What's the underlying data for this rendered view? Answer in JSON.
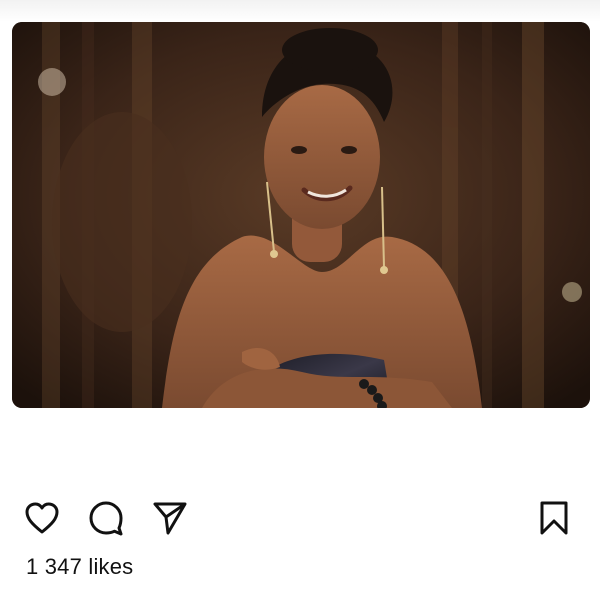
{
  "post": {
    "image_description_name": "post-photo",
    "likes_text": "1 347 likes",
    "caption": {
      "username": "",
      "text": ""
    }
  },
  "actions": {
    "like_icon": "heart-icon",
    "comment_icon": "comment-icon",
    "share_icon": "send-icon",
    "save_icon": "bookmark-icon"
  },
  "colors": {
    "icon_stroke": "#111111",
    "background": "#ffffff"
  }
}
